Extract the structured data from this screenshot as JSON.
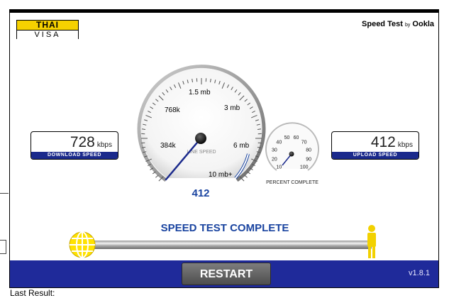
{
  "logo": {
    "top": "THAI",
    "bottom": "VISA"
  },
  "brand": {
    "prefix": "Speed Test",
    "by": "by",
    "name": "Ookla"
  },
  "download": {
    "value": "728",
    "unit": "kbps",
    "label": "DOWNLOAD SPEED"
  },
  "upload": {
    "value": "412",
    "unit": "kbps",
    "label": "UPLOAD SPEED"
  },
  "line_gauge": {
    "ticks": [
      "384k",
      "768k",
      "1.5 mb",
      "3 mb",
      "6 mb",
      "10 mb+"
    ],
    "center_label": "LINE SPEED",
    "reading": "412"
  },
  "percent_gauge": {
    "ticks": [
      "10",
      "20",
      "30",
      "40",
      "50",
      "60",
      "70",
      "80",
      "90",
      "100"
    ],
    "label": "PERCENT COMPLETE"
  },
  "status": "SPEED TEST COMPLETE",
  "restart_label": "RESTART",
  "version": "v1.8.1",
  "page": {
    "last_result": "Last Result:"
  },
  "colors": {
    "bar": "#1f2a9a",
    "status": "#1a44a0",
    "logo_yellow": "#f6d100",
    "needle": "#1b2a8c"
  },
  "icons": {
    "start": "globe-icon",
    "end": "person-icon"
  }
}
